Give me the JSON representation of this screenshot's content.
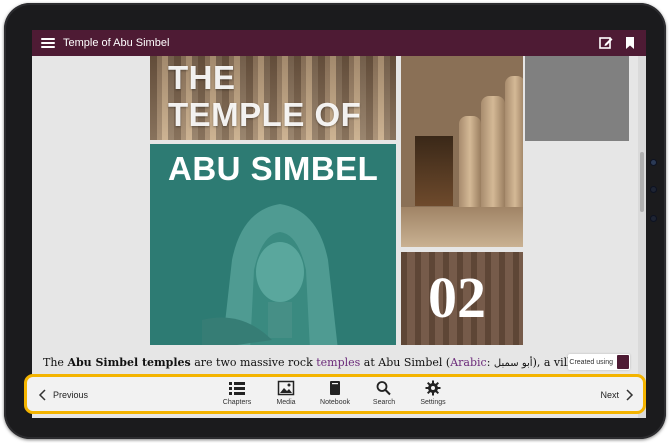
{
  "app": {
    "title": "Temple of Abu Simbel"
  },
  "cover": {
    "title_line1": "THE",
    "title_line2": "TEMPLE OF",
    "title_line3": "ABU SIMBEL",
    "chapter_number": "02"
  },
  "paragraph": {
    "part1": "The ",
    "bold": "Abu Simbel temples",
    "part2": " are two massive rock ",
    "link1": "temples",
    "part3": " at Abu Simbel (",
    "link2": "Arabic",
    "part4": ": ",
    "arabic": "أبو سمبل",
    "part5": "), a villag"
  },
  "badge": {
    "text": "Created using"
  },
  "bottom_bar": {
    "previous_label": "Previous",
    "next_label": "Next",
    "tools": [
      {
        "label": "Chapters",
        "icon": "list-icon"
      },
      {
        "label": "Media",
        "icon": "image-icon"
      },
      {
        "label": "Notebook",
        "icon": "notebook-icon"
      },
      {
        "label": "Search",
        "icon": "search-icon"
      },
      {
        "label": "Settings",
        "icon": "gear-icon"
      }
    ]
  },
  "colors": {
    "app_bar": "#4e1b34",
    "highlight_border": "#f4b400",
    "cover_teal": "#2d7b73",
    "link": "#6b2a7a"
  }
}
